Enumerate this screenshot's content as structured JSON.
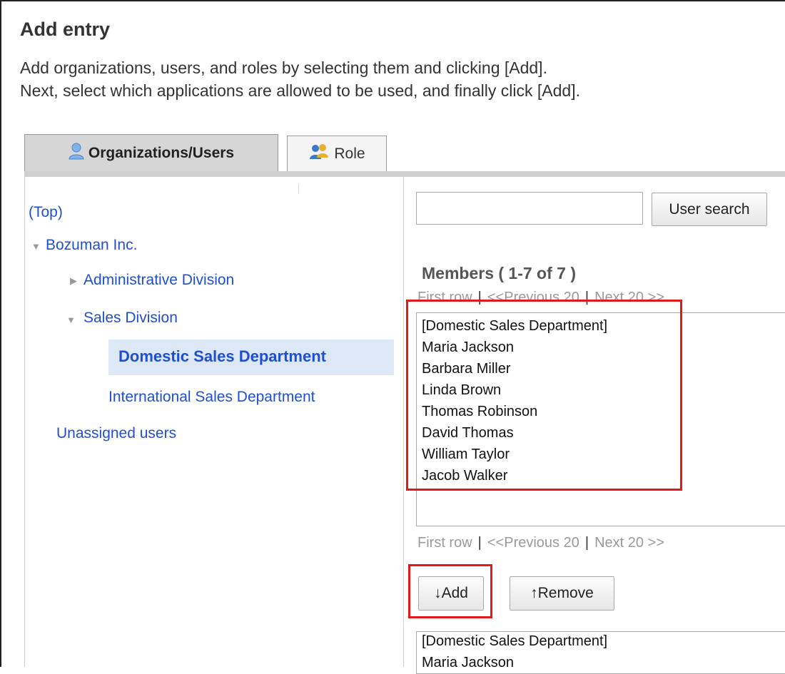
{
  "header": {
    "title": "Add entry",
    "description_line1": "Add organizations, users, and roles by selecting them and clicking [Add].",
    "description_line2": "Next, select which applications are allowed to be used, and finally click [Add]."
  },
  "tabs": [
    {
      "label": "Organizations/Users",
      "icon": "user-icon",
      "active": true
    },
    {
      "label": "Role",
      "icon": "role-icon",
      "active": false
    }
  ],
  "tree": {
    "top": "(Top)",
    "company": "Bozuman Inc.",
    "admin_division": "Administrative Division",
    "sales_division": "Sales Division",
    "domestic": "Domestic Sales Department",
    "international": "International Sales Department",
    "unassigned": "Unassigned users"
  },
  "search": {
    "value": "",
    "button_label": "User search"
  },
  "members": {
    "title": "Members ( 1-7 of 7 )",
    "pager": {
      "first": "First row",
      "prev": "<<Previous 20",
      "next": "Next 20 >>",
      "separator": "|"
    },
    "items": [
      "[Domestic Sales Department]",
      "Maria Jackson",
      "Barbara Miller",
      "Linda Brown",
      "Thomas Robinson",
      "David Thomas",
      "William Taylor",
      "Jacob Walker"
    ]
  },
  "actions": {
    "add_label": "↓Add",
    "remove_label": "↑Remove"
  },
  "selected": {
    "items": [
      "[Domestic Sales Department]",
      "Maria Jackson"
    ]
  },
  "colors": {
    "link": "#1f4fd0",
    "highlight": "#e01a1a",
    "selected_bg": "#dde8f6"
  }
}
